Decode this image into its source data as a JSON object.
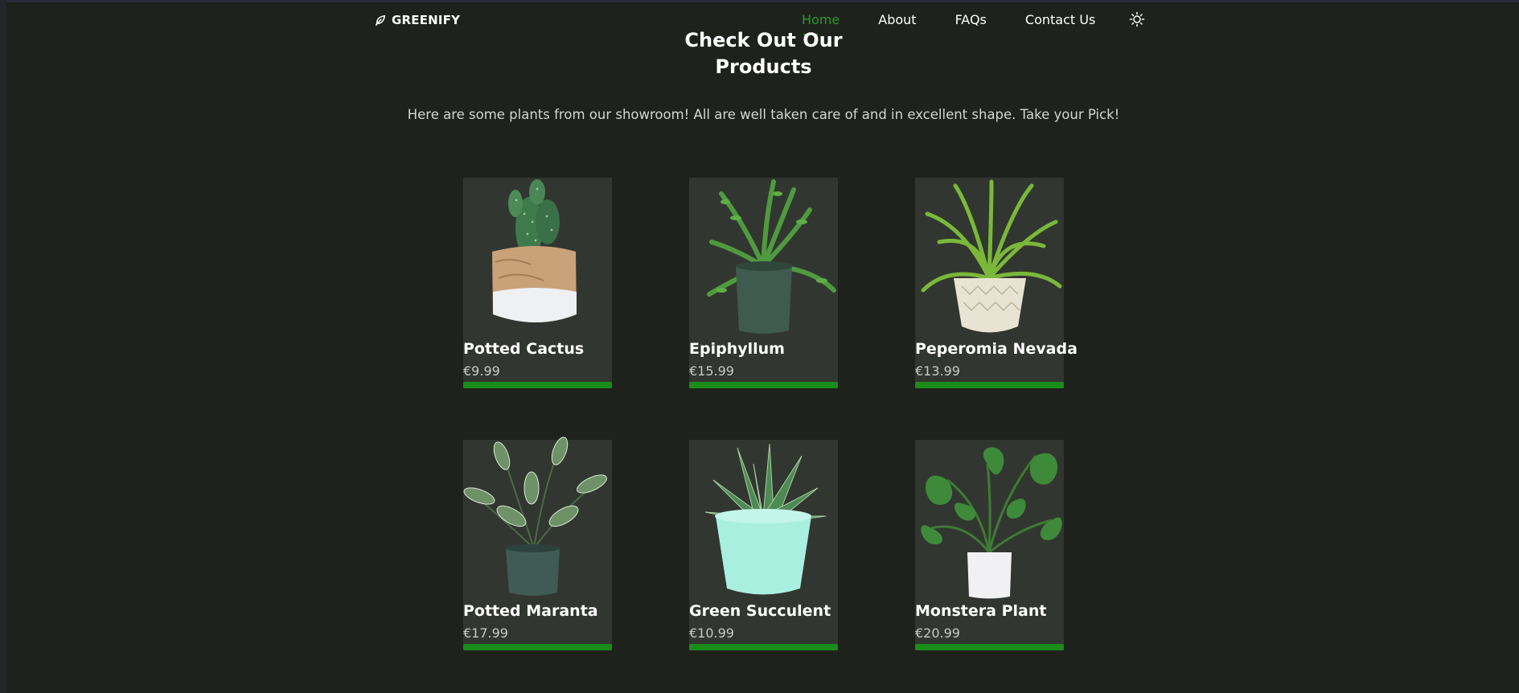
{
  "brand": {
    "name": "GREENIFY",
    "icon": "leaf-icon"
  },
  "nav": {
    "items": [
      {
        "label": "Home",
        "active": true
      },
      {
        "label": "About",
        "active": false
      },
      {
        "label": "FAQs",
        "active": false
      },
      {
        "label": "Contact Us",
        "active": false
      }
    ],
    "theme_icon": "sun-icon"
  },
  "section": {
    "title_line1": "Check Out Our",
    "title_line2": "Products",
    "intro": "Here are some plants from our showroom! All are well taken care of and in excellent shape. Take your Pick!"
  },
  "products": [
    {
      "name": "Potted Cactus",
      "price": "€9.99",
      "image": "cactus-image"
    },
    {
      "name": "Epiphyllum",
      "price": "€15.99",
      "image": "epiphyllum-image"
    },
    {
      "name": "Peperomia Nevada",
      "price": "€13.99",
      "image": "peperomia-image"
    },
    {
      "name": "Potted Maranta",
      "price": "€17.99",
      "image": "maranta-image"
    },
    {
      "name": "Green Succulent",
      "price": "€10.99",
      "image": "succulent-image"
    },
    {
      "name": "Monstera Plant",
      "price": "€20.99",
      "image": "monstera-image"
    }
  ],
  "colors": {
    "background": "#1e211c",
    "card": "#323630",
    "accent": "#1a8c1a",
    "active_nav": "#2b9a2b"
  }
}
